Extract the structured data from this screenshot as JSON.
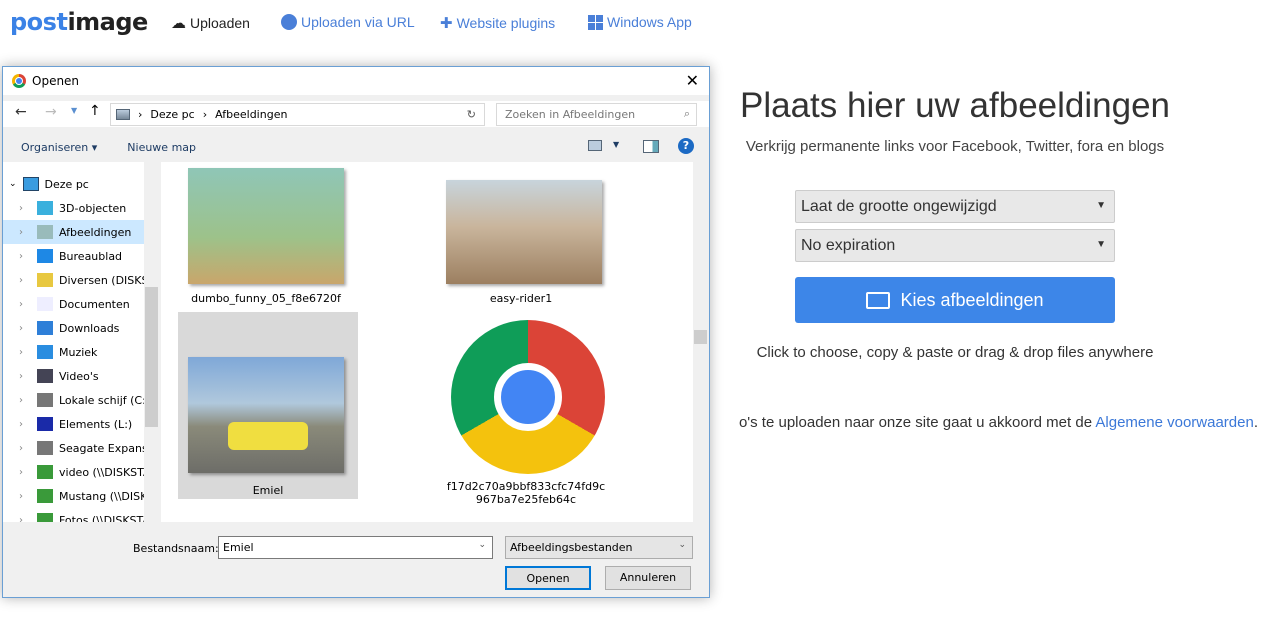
{
  "header": {
    "logo_a": "post",
    "logo_b": "image",
    "nav": [
      {
        "label": "Uploaden",
        "icon": "cloud-upload-icon"
      },
      {
        "label": "Uploaden via URL",
        "icon": "globe-icon"
      },
      {
        "label": "Website plugins",
        "icon": "puzzle-icon"
      },
      {
        "label": "Windows App",
        "icon": "windows-icon"
      }
    ]
  },
  "main": {
    "title": "Plaats hier uw afbeeldingen",
    "subtitle": "Verkrijg permanente links voor Facebook, Twitter, fora en blogs",
    "resize_select": "Laat de grootte ongewijzigd",
    "expiration_select": "No expiration",
    "choose_button": "Kies afbeeldingen",
    "hint": "Click to choose, copy & paste or drag & drop files anywhere",
    "terms_text": "o's te uploaden naar onze site gaat u akkoord met de ",
    "terms_link": "Algemene voorwaarden",
    "terms_end": ".",
    "accent": "#3d86e8"
  },
  "dialog": {
    "title": "Openen",
    "breadcrumb": [
      "Deze pc",
      "Afbeeldingen"
    ],
    "search_placeholder": "Zoeken in Afbeeldingen",
    "organize": "Organiseren ▾",
    "new_folder": "Nieuwe map",
    "tree_root": "Deze pc",
    "tree": [
      {
        "label": "3D-objecten",
        "icon": "3d-objects-icon"
      },
      {
        "label": "Afbeeldingen",
        "icon": "pictures-icon",
        "selected": true
      },
      {
        "label": "Bureaublad",
        "icon": "desktop-icon"
      },
      {
        "label": "Diversen (DISKST",
        "icon": "network-folder-icon"
      },
      {
        "label": "Documenten",
        "icon": "documents-icon"
      },
      {
        "label": "Downloads",
        "icon": "downloads-icon"
      },
      {
        "label": "Muziek",
        "icon": "music-icon"
      },
      {
        "label": "Video's",
        "icon": "videos-icon"
      },
      {
        "label": "Lokale schijf (C:)",
        "icon": "drive-icon"
      },
      {
        "label": "Elements (L:)",
        "icon": "wd-drive-icon"
      },
      {
        "label": "Seagate Expansic",
        "icon": "drive-icon"
      },
      {
        "label": "video (\\\\DISKSTA",
        "icon": "network-drive-icon"
      },
      {
        "label": "Mustang (\\\\DISK",
        "icon": "network-drive-icon"
      },
      {
        "label": "Fotos (\\\\DISKSTA",
        "icon": "network-drive-icon"
      }
    ],
    "files": [
      {
        "name": "dumbo_funny_05_f8e6720f"
      },
      {
        "name": "easy-rider1"
      },
      {
        "name": "Emiel",
        "selected": true
      },
      {
        "name": "f17d2c70a9bbf833cfc74fd9c967ba7e25feb64c"
      }
    ],
    "filename_label": "Bestandsnaam:",
    "filename_value": "Emiel",
    "filetype": "Afbeeldingsbestanden",
    "open_button": "Openen",
    "cancel_button": "Annuleren"
  }
}
